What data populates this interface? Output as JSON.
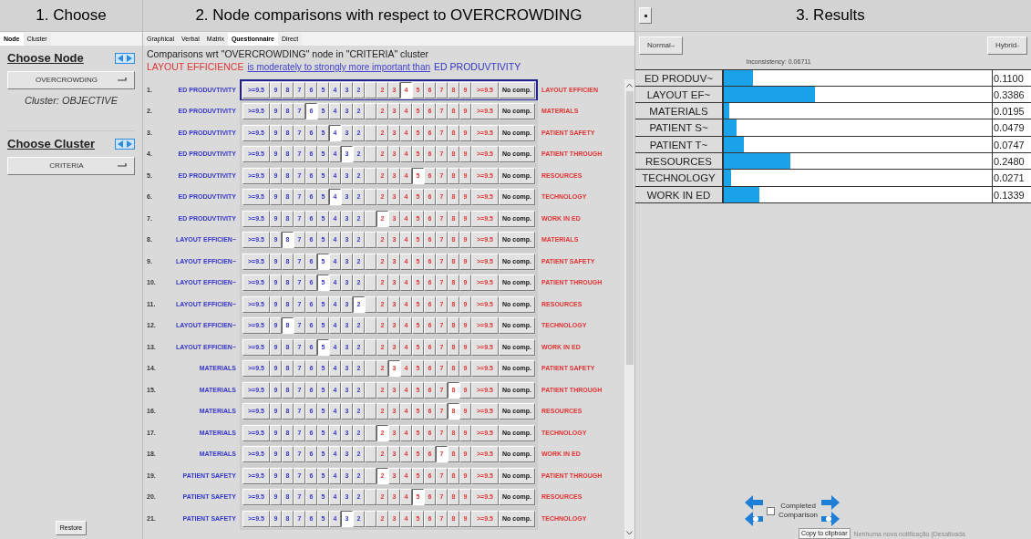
{
  "choose_panel": {
    "title": "1. Choose",
    "tabs": [
      {
        "label": "Node",
        "selected": true
      },
      {
        "label": "Cluster",
        "selected": false
      }
    ],
    "node_heading": "Choose Node",
    "node_dropdown": "OVERCROWDING",
    "cluster_note": "Cluster: OBJECTIVE",
    "cluster_heading": "Choose Cluster",
    "cluster_dropdown": "CRITERIA",
    "restore_button": "Restore"
  },
  "comparison_panel": {
    "title": "2. Node comparisons with respect to OVERCROWDING",
    "tabs": [
      {
        "label": "Graphical",
        "selected": false
      },
      {
        "label": "Verbal",
        "selected": false
      },
      {
        "label": "Matrix",
        "selected": false
      },
      {
        "label": "Questionnaire",
        "selected": true
      },
      {
        "label": "Direct",
        "selected": false
      }
    ],
    "context": "Comparisons wrt \"OVERCROWDING\" node in \"CRITERIA\" cluster",
    "statement": {
      "more_important": "LAYOUT EFFICIENCE",
      "relation": "is moderately to strongly more important than",
      "less_important": "ED PRODUVTIVITY"
    },
    "rows": [
      {
        "number": "1.",
        "selected": true,
        "left": "ED PRODUVTIVITY",
        "right": "LAYOUT EFFICIEN",
        "no_comp": "No comp.",
        "left_scale": [
          {
            "label": ">=9.5",
            "selected": false
          },
          {
            "label": "9",
            "selected": false
          },
          {
            "label": "8",
            "selected": false
          },
          {
            "label": "7",
            "selected": false
          },
          {
            "label": "6",
            "selected": false
          },
          {
            "label": "5",
            "selected": false
          },
          {
            "label": "4",
            "selected": false
          },
          {
            "label": "3",
            "selected": false
          },
          {
            "label": "2",
            "selected": false
          }
        ],
        "right_scale": [
          {
            "label": "2",
            "selected": false
          },
          {
            "label": "3",
            "selected": false
          },
          {
            "label": "4",
            "selected": true
          },
          {
            "label": "5",
            "selected": false
          },
          {
            "label": "6",
            "selected": false
          },
          {
            "label": "7",
            "selected": false
          },
          {
            "label": "8",
            "selected": false
          },
          {
            "label": "9",
            "selected": false
          },
          {
            "label": ">=9.5",
            "selected": false
          }
        ]
      },
      {
        "number": "2.",
        "selected": false,
        "left": "ED PRODUVTIVITY",
        "right": "MATERIALS",
        "no_comp": "No comp.",
        "left_scale": [
          {
            "label": ">=9.5",
            "selected": false
          },
          {
            "label": "9",
            "selected": false
          },
          {
            "label": "8",
            "selected": false
          },
          {
            "label": "7",
            "selected": false
          },
          {
            "label": "6",
            "selected": true
          },
          {
            "label": "5",
            "selected": false
          },
          {
            "label": "4",
            "selected": false
          },
          {
            "label": "3",
            "selected": false
          },
          {
            "label": "2",
            "selected": false
          }
        ],
        "right_scale": [
          {
            "label": "2",
            "selected": false
          },
          {
            "label": "3",
            "selected": false
          },
          {
            "label": "4",
            "selected": false
          },
          {
            "label": "5",
            "selected": false
          },
          {
            "label": "6",
            "selected": false
          },
          {
            "label": "7",
            "selected": false
          },
          {
            "label": "8",
            "selected": false
          },
          {
            "label": "9",
            "selected": false
          },
          {
            "label": ">=9.5",
            "selected": false
          }
        ]
      },
      {
        "number": "3.",
        "selected": false,
        "left": "ED PRODUVTIVITY",
        "right": "PATIENT SAFETY",
        "no_comp": "No comp.",
        "left_scale": [
          {
            "label": ">=9.5",
            "selected": false
          },
          {
            "label": "9",
            "selected": false
          },
          {
            "label": "8",
            "selected": false
          },
          {
            "label": "7",
            "selected": false
          },
          {
            "label": "6",
            "selected": false
          },
          {
            "label": "5",
            "selected": false
          },
          {
            "label": "4",
            "selected": true
          },
          {
            "label": "3",
            "selected": false
          },
          {
            "label": "2",
            "selected": false
          }
        ],
        "right_scale": [
          {
            "label": "2",
            "selected": false
          },
          {
            "label": "3",
            "selected": false
          },
          {
            "label": "4",
            "selected": false
          },
          {
            "label": "5",
            "selected": false
          },
          {
            "label": "6",
            "selected": false
          },
          {
            "label": "7",
            "selected": false
          },
          {
            "label": "8",
            "selected": false
          },
          {
            "label": "9",
            "selected": false
          },
          {
            "label": ">=9.5",
            "selected": false
          }
        ]
      },
      {
        "number": "4.",
        "selected": false,
        "left": "ED PRODUVTIVITY",
        "right": "PATIENT THROUGH",
        "no_comp": "No comp.",
        "left_scale": [
          {
            "label": ">=9.5",
            "selected": false
          },
          {
            "label": "9",
            "selected": false
          },
          {
            "label": "8",
            "selected": false
          },
          {
            "label": "7",
            "selected": false
          },
          {
            "label": "6",
            "selected": false
          },
          {
            "label": "5",
            "selected": false
          },
          {
            "label": "4",
            "selected": false
          },
          {
            "label": "3",
            "selected": true
          },
          {
            "label": "2",
            "selected": false
          }
        ],
        "right_scale": [
          {
            "label": "2",
            "selected": false
          },
          {
            "label": "3",
            "selected": false
          },
          {
            "label": "4",
            "selected": false
          },
          {
            "label": "5",
            "selected": false
          },
          {
            "label": "6",
            "selected": false
          },
          {
            "label": "7",
            "selected": false
          },
          {
            "label": "8",
            "selected": false
          },
          {
            "label": "9",
            "selected": false
          },
          {
            "label": ">=9.5",
            "selected": false
          }
        ]
      },
      {
        "number": "5.",
        "selected": false,
        "left": "ED PRODUVTIVITY",
        "right": "RESOURCES",
        "no_comp": "No comp.",
        "left_scale": [
          {
            "label": ">=9.5",
            "selected": false
          },
          {
            "label": "9",
            "selected": false
          },
          {
            "label": "8",
            "selected": false
          },
          {
            "label": "7",
            "selected": false
          },
          {
            "label": "6",
            "selected": false
          },
          {
            "label": "5",
            "selected": false
          },
          {
            "label": "4",
            "selected": false
          },
          {
            "label": "3",
            "selected": false
          },
          {
            "label": "2",
            "selected": false
          }
        ],
        "right_scale": [
          {
            "label": "2",
            "selected": false
          },
          {
            "label": "3",
            "selected": false
          },
          {
            "label": "4",
            "selected": false
          },
          {
            "label": "5",
            "selected": true
          },
          {
            "label": "6",
            "selected": false
          },
          {
            "label": "7",
            "selected": false
          },
          {
            "label": "8",
            "selected": false
          },
          {
            "label": "9",
            "selected": false
          },
          {
            "label": ">=9.5",
            "selected": false
          }
        ]
      },
      {
        "number": "6.",
        "selected": false,
        "left": "ED PRODUVTIVITY",
        "right": "TECHNOLOGY",
        "no_comp": "No comp.",
        "left_scale": [
          {
            "label": ">=9.5",
            "selected": false
          },
          {
            "label": "9",
            "selected": false
          },
          {
            "label": "8",
            "selected": false
          },
          {
            "label": "7",
            "selected": false
          },
          {
            "label": "6",
            "selected": false
          },
          {
            "label": "5",
            "selected": false
          },
          {
            "label": "4",
            "selected": true
          },
          {
            "label": "3",
            "selected": false
          },
          {
            "label": "2",
            "selected": false
          }
        ],
        "right_scale": [
          {
            "label": "2",
            "selected": false
          },
          {
            "label": "3",
            "selected": false
          },
          {
            "label": "4",
            "selected": false
          },
          {
            "label": "5",
            "selected": false
          },
          {
            "label": "6",
            "selected": false
          },
          {
            "label": "7",
            "selected": false
          },
          {
            "label": "8",
            "selected": false
          },
          {
            "label": "9",
            "selected": false
          },
          {
            "label": ">=9.5",
            "selected": false
          }
        ]
      },
      {
        "number": "7.",
        "selected": false,
        "left": "ED PRODUVTIVITY",
        "right": "WORK IN ED",
        "no_comp": "No comp.",
        "left_scale": [
          {
            "label": ">=9.5",
            "selected": false
          },
          {
            "label": "9",
            "selected": false
          },
          {
            "label": "8",
            "selected": false
          },
          {
            "label": "7",
            "selected": false
          },
          {
            "label": "6",
            "selected": false
          },
          {
            "label": "5",
            "selected": false
          },
          {
            "label": "4",
            "selected": false
          },
          {
            "label": "3",
            "selected": false
          },
          {
            "label": "2",
            "selected": false
          }
        ],
        "right_scale": [
          {
            "label": "2",
            "selected": true
          },
          {
            "label": "3",
            "selected": false
          },
          {
            "label": "4",
            "selected": false
          },
          {
            "label": "5",
            "selected": false
          },
          {
            "label": "6",
            "selected": false
          },
          {
            "label": "7",
            "selected": false
          },
          {
            "label": "8",
            "selected": false
          },
          {
            "label": "9",
            "selected": false
          },
          {
            "label": ">=9.5",
            "selected": false
          }
        ]
      },
      {
        "number": "8.",
        "selected": false,
        "left": "LAYOUT EFFICIEN~",
        "right": "MATERIALS",
        "no_comp": "No comp.",
        "left_scale": [
          {
            "label": ">=9.5",
            "selected": false
          },
          {
            "label": "9",
            "selected": false
          },
          {
            "label": "8",
            "selected": true
          },
          {
            "label": "7",
            "selected": false
          },
          {
            "label": "6",
            "selected": false
          },
          {
            "label": "5",
            "selected": false
          },
          {
            "label": "4",
            "selected": false
          },
          {
            "label": "3",
            "selected": false
          },
          {
            "label": "2",
            "selected": false
          }
        ],
        "right_scale": [
          {
            "label": "2",
            "selected": false
          },
          {
            "label": "3",
            "selected": false
          },
          {
            "label": "4",
            "selected": false
          },
          {
            "label": "5",
            "selected": false
          },
          {
            "label": "6",
            "selected": false
          },
          {
            "label": "7",
            "selected": false
          },
          {
            "label": "8",
            "selected": false
          },
          {
            "label": "9",
            "selected": false
          },
          {
            "label": ">=9.5",
            "selected": false
          }
        ]
      },
      {
        "number": "9.",
        "selected": false,
        "left": "LAYOUT EFFICIEN~",
        "right": "PATIENT SAFETY",
        "no_comp": "No comp.",
        "left_scale": [
          {
            "label": ">=9.5",
            "selected": false
          },
          {
            "label": "9",
            "selected": false
          },
          {
            "label": "8",
            "selected": false
          },
          {
            "label": "7",
            "selected": false
          },
          {
            "label": "6",
            "selected": false
          },
          {
            "label": "5",
            "selected": true
          },
          {
            "label": "4",
            "selected": false
          },
          {
            "label": "3",
            "selected": false
          },
          {
            "label": "2",
            "selected": false
          }
        ],
        "right_scale": [
          {
            "label": "2",
            "selected": false
          },
          {
            "label": "3",
            "selected": false
          },
          {
            "label": "4",
            "selected": false
          },
          {
            "label": "5",
            "selected": false
          },
          {
            "label": "6",
            "selected": false
          },
          {
            "label": "7",
            "selected": false
          },
          {
            "label": "8",
            "selected": false
          },
          {
            "label": "9",
            "selected": false
          },
          {
            "label": ">=9.5",
            "selected": false
          }
        ]
      },
      {
        "number": "10.",
        "selected": false,
        "left": "LAYOUT EFFICIEN~",
        "right": "PATIENT THROUGH",
        "no_comp": "No comp.",
        "left_scale": [
          {
            "label": ">=9.5",
            "selected": false
          },
          {
            "label": "9",
            "selected": false
          },
          {
            "label": "8",
            "selected": false
          },
          {
            "label": "7",
            "selected": false
          },
          {
            "label": "6",
            "selected": false
          },
          {
            "label": "5",
            "selected": true
          },
          {
            "label": "4",
            "selected": false
          },
          {
            "label": "3",
            "selected": false
          },
          {
            "label": "2",
            "selected": false
          }
        ],
        "right_scale": [
          {
            "label": "2",
            "selected": false
          },
          {
            "label": "3",
            "selected": false
          },
          {
            "label": "4",
            "selected": false
          },
          {
            "label": "5",
            "selected": false
          },
          {
            "label": "6",
            "selected": false
          },
          {
            "label": "7",
            "selected": false
          },
          {
            "label": "8",
            "selected": false
          },
          {
            "label": "9",
            "selected": false
          },
          {
            "label": ">=9.5",
            "selected": false
          }
        ]
      },
      {
        "number": "11.",
        "selected": false,
        "left": "LAYOUT EFFICIEN~",
        "right": "RESOURCES",
        "no_comp": "No comp.",
        "left_scale": [
          {
            "label": ">=9.5",
            "selected": false
          },
          {
            "label": "9",
            "selected": false
          },
          {
            "label": "8",
            "selected": false
          },
          {
            "label": "7",
            "selected": false
          },
          {
            "label": "6",
            "selected": false
          },
          {
            "label": "5",
            "selected": false
          },
          {
            "label": "4",
            "selected": false
          },
          {
            "label": "3",
            "selected": false
          },
          {
            "label": "2",
            "selected": true
          }
        ],
        "right_scale": [
          {
            "label": "2",
            "selected": false
          },
          {
            "label": "3",
            "selected": false
          },
          {
            "label": "4",
            "selected": false
          },
          {
            "label": "5",
            "selected": false
          },
          {
            "label": "6",
            "selected": false
          },
          {
            "label": "7",
            "selected": false
          },
          {
            "label": "8",
            "selected": false
          },
          {
            "label": "9",
            "selected": false
          },
          {
            "label": ">=9.5",
            "selected": false
          }
        ]
      },
      {
        "number": "12.",
        "selected": false,
        "left": "LAYOUT EFFICIEN~",
        "right": "TECHNOLOGY",
        "no_comp": "No comp.",
        "left_scale": [
          {
            "label": ">=9.5",
            "selected": false
          },
          {
            "label": "9",
            "selected": false
          },
          {
            "label": "8",
            "selected": true
          },
          {
            "label": "7",
            "selected": false
          },
          {
            "label": "6",
            "selected": false
          },
          {
            "label": "5",
            "selected": false
          },
          {
            "label": "4",
            "selected": false
          },
          {
            "label": "3",
            "selected": false
          },
          {
            "label": "2",
            "selected": false
          }
        ],
        "right_scale": [
          {
            "label": "2",
            "selected": false
          },
          {
            "label": "3",
            "selected": false
          },
          {
            "label": "4",
            "selected": false
          },
          {
            "label": "5",
            "selected": false
          },
          {
            "label": "6",
            "selected": false
          },
          {
            "label": "7",
            "selected": false
          },
          {
            "label": "8",
            "selected": false
          },
          {
            "label": "9",
            "selected": false
          },
          {
            "label": ">=9.5",
            "selected": false
          }
        ]
      },
      {
        "number": "13.",
        "selected": false,
        "left": "LAYOUT EFFICIEN~",
        "right": "WORK IN ED",
        "no_comp": "No comp.",
        "left_scale": [
          {
            "label": ">=9.5",
            "selected": false
          },
          {
            "label": "9",
            "selected": false
          },
          {
            "label": "8",
            "selected": false
          },
          {
            "label": "7",
            "selected": false
          },
          {
            "label": "6",
            "selected": false
          },
          {
            "label": "5",
            "selected": true
          },
          {
            "label": "4",
            "selected": false
          },
          {
            "label": "3",
            "selected": false
          },
          {
            "label": "2",
            "selected": false
          }
        ],
        "right_scale": [
          {
            "label": "2",
            "selected": false
          },
          {
            "label": "3",
            "selected": false
          },
          {
            "label": "4",
            "selected": false
          },
          {
            "label": "5",
            "selected": false
          },
          {
            "label": "6",
            "selected": false
          },
          {
            "label": "7",
            "selected": false
          },
          {
            "label": "8",
            "selected": false
          },
          {
            "label": "9",
            "selected": false
          },
          {
            "label": ">=9.5",
            "selected": false
          }
        ]
      },
      {
        "number": "14.",
        "selected": false,
        "left": "MATERIALS",
        "right": "PATIENT SAFETY",
        "no_comp": "No comp.",
        "left_scale": [
          {
            "label": ">=9.5",
            "selected": false
          },
          {
            "label": "9",
            "selected": false
          },
          {
            "label": "8",
            "selected": false
          },
          {
            "label": "7",
            "selected": false
          },
          {
            "label": "6",
            "selected": false
          },
          {
            "label": "5",
            "selected": false
          },
          {
            "label": "4",
            "selected": false
          },
          {
            "label": "3",
            "selected": false
          },
          {
            "label": "2",
            "selected": false
          }
        ],
        "right_scale": [
          {
            "label": "2",
            "selected": false
          },
          {
            "label": "3",
            "selected": true
          },
          {
            "label": "4",
            "selected": false
          },
          {
            "label": "5",
            "selected": false
          },
          {
            "label": "6",
            "selected": false
          },
          {
            "label": "7",
            "selected": false
          },
          {
            "label": "8",
            "selected": false
          },
          {
            "label": "9",
            "selected": false
          },
          {
            "label": ">=9.5",
            "selected": false
          }
        ]
      },
      {
        "number": "15.",
        "selected": false,
        "left": "MATERIALS",
        "right": "PATIENT THROUGH",
        "no_comp": "No comp.",
        "left_scale": [
          {
            "label": ">=9.5",
            "selected": false
          },
          {
            "label": "9",
            "selected": false
          },
          {
            "label": "8",
            "selected": false
          },
          {
            "label": "7",
            "selected": false
          },
          {
            "label": "6",
            "selected": false
          },
          {
            "label": "5",
            "selected": false
          },
          {
            "label": "4",
            "selected": false
          },
          {
            "label": "3",
            "selected": false
          },
          {
            "label": "2",
            "selected": false
          }
        ],
        "right_scale": [
          {
            "label": "2",
            "selected": false
          },
          {
            "label": "3",
            "selected": false
          },
          {
            "label": "4",
            "selected": false
          },
          {
            "label": "5",
            "selected": false
          },
          {
            "label": "6",
            "selected": false
          },
          {
            "label": "7",
            "selected": false
          },
          {
            "label": "8",
            "selected": true
          },
          {
            "label": "9",
            "selected": false
          },
          {
            "label": ">=9.5",
            "selected": false
          }
        ]
      },
      {
        "number": "16.",
        "selected": false,
        "left": "MATERIALS",
        "right": "RESOURCES",
        "no_comp": "No comp.",
        "left_scale": [
          {
            "label": ">=9.5",
            "selected": false
          },
          {
            "label": "9",
            "selected": false
          },
          {
            "label": "8",
            "selected": false
          },
          {
            "label": "7",
            "selected": false
          },
          {
            "label": "6",
            "selected": false
          },
          {
            "label": "5",
            "selected": false
          },
          {
            "label": "4",
            "selected": false
          },
          {
            "label": "3",
            "selected": false
          },
          {
            "label": "2",
            "selected": false
          }
        ],
        "right_scale": [
          {
            "label": "2",
            "selected": false
          },
          {
            "label": "3",
            "selected": false
          },
          {
            "label": "4",
            "selected": false
          },
          {
            "label": "5",
            "selected": false
          },
          {
            "label": "6",
            "selected": false
          },
          {
            "label": "7",
            "selected": false
          },
          {
            "label": "8",
            "selected": true
          },
          {
            "label": "9",
            "selected": false
          },
          {
            "label": ">=9.5",
            "selected": false
          }
        ]
      },
      {
        "number": "17.",
        "selected": false,
        "left": "MATERIALS",
        "right": "TECHNOLOGY",
        "no_comp": "No comp.",
        "left_scale": [
          {
            "label": ">=9.5",
            "selected": false
          },
          {
            "label": "9",
            "selected": false
          },
          {
            "label": "8",
            "selected": false
          },
          {
            "label": "7",
            "selected": false
          },
          {
            "label": "6",
            "selected": false
          },
          {
            "label": "5",
            "selected": false
          },
          {
            "label": "4",
            "selected": false
          },
          {
            "label": "3",
            "selected": false
          },
          {
            "label": "2",
            "selected": false
          }
        ],
        "right_scale": [
          {
            "label": "2",
            "selected": true
          },
          {
            "label": "3",
            "selected": false
          },
          {
            "label": "4",
            "selected": false
          },
          {
            "label": "5",
            "selected": false
          },
          {
            "label": "6",
            "selected": false
          },
          {
            "label": "7",
            "selected": false
          },
          {
            "label": "8",
            "selected": false
          },
          {
            "label": "9",
            "selected": false
          },
          {
            "label": ">=9.5",
            "selected": false
          }
        ]
      },
      {
        "number": "18.",
        "selected": false,
        "left": "MATERIALS",
        "right": "WORK IN ED",
        "no_comp": "No comp.",
        "left_scale": [
          {
            "label": ">=9.5",
            "selected": false
          },
          {
            "label": "9",
            "selected": false
          },
          {
            "label": "8",
            "selected": false
          },
          {
            "label": "7",
            "selected": false
          },
          {
            "label": "6",
            "selected": false
          },
          {
            "label": "5",
            "selected": false
          },
          {
            "label": "4",
            "selected": false
          },
          {
            "label": "3",
            "selected": false
          },
          {
            "label": "2",
            "selected": false
          }
        ],
        "right_scale": [
          {
            "label": "2",
            "selected": false
          },
          {
            "label": "3",
            "selected": false
          },
          {
            "label": "4",
            "selected": false
          },
          {
            "label": "5",
            "selected": false
          },
          {
            "label": "6",
            "selected": false
          },
          {
            "label": "7",
            "selected": true
          },
          {
            "label": "8",
            "selected": false
          },
          {
            "label": "9",
            "selected": false
          },
          {
            "label": ">=9.5",
            "selected": false
          }
        ]
      },
      {
        "number": "19.",
        "selected": false,
        "left": "PATIENT SAFETY",
        "right": "PATIENT THROUGH",
        "no_comp": "No comp.",
        "left_scale": [
          {
            "label": ">=9.5",
            "selected": false
          },
          {
            "label": "9",
            "selected": false
          },
          {
            "label": "8",
            "selected": false
          },
          {
            "label": "7",
            "selected": false
          },
          {
            "label": "6",
            "selected": false
          },
          {
            "label": "5",
            "selected": false
          },
          {
            "label": "4",
            "selected": false
          },
          {
            "label": "3",
            "selected": false
          },
          {
            "label": "2",
            "selected": false
          }
        ],
        "right_scale": [
          {
            "label": "2",
            "selected": true
          },
          {
            "label": "3",
            "selected": false
          },
          {
            "label": "4",
            "selected": false
          },
          {
            "label": "5",
            "selected": false
          },
          {
            "label": "6",
            "selected": false
          },
          {
            "label": "7",
            "selected": false
          },
          {
            "label": "8",
            "selected": false
          },
          {
            "label": "9",
            "selected": false
          },
          {
            "label": ">=9.5",
            "selected": false
          }
        ]
      },
      {
        "number": "20.",
        "selected": false,
        "left": "PATIENT SAFETY",
        "right": "RESOURCES",
        "no_comp": "No comp.",
        "left_scale": [
          {
            "label": ">=9.5",
            "selected": false
          },
          {
            "label": "9",
            "selected": false
          },
          {
            "label": "8",
            "selected": false
          },
          {
            "label": "7",
            "selected": false
          },
          {
            "label": "6",
            "selected": false
          },
          {
            "label": "5",
            "selected": false
          },
          {
            "label": "4",
            "selected": false
          },
          {
            "label": "3",
            "selected": false
          },
          {
            "label": "2",
            "selected": false
          }
        ],
        "right_scale": [
          {
            "label": "2",
            "selected": false
          },
          {
            "label": "3",
            "selected": false
          },
          {
            "label": "4",
            "selected": false
          },
          {
            "label": "5",
            "selected": true
          },
          {
            "label": "6",
            "selected": false
          },
          {
            "label": "7",
            "selected": false
          },
          {
            "label": "8",
            "selected": false
          },
          {
            "label": "9",
            "selected": false
          },
          {
            "label": ">=9.5",
            "selected": false
          }
        ]
      },
      {
        "number": "21.",
        "selected": false,
        "left": "PATIENT SAFETY",
        "right": "TECHNOLOGY",
        "no_comp": "No comp.",
        "left_scale": [
          {
            "label": ">=9.5",
            "selected": false
          },
          {
            "label": "9",
            "selected": false
          },
          {
            "label": "8",
            "selected": false
          },
          {
            "label": "7",
            "selected": false
          },
          {
            "label": "6",
            "selected": false
          },
          {
            "label": "5",
            "selected": false
          },
          {
            "label": "4",
            "selected": false
          },
          {
            "label": "3",
            "selected": true
          },
          {
            "label": "2",
            "selected": false
          }
        ],
        "right_scale": [
          {
            "label": "2",
            "selected": false
          },
          {
            "label": "3",
            "selected": false
          },
          {
            "label": "4",
            "selected": false
          },
          {
            "label": "5",
            "selected": false
          },
          {
            "label": "6",
            "selected": false
          },
          {
            "label": "7",
            "selected": false
          },
          {
            "label": "8",
            "selected": false
          },
          {
            "label": "9",
            "selected": false
          },
          {
            "label": ">=9.5",
            "selected": false
          }
        ]
      }
    ]
  },
  "results_panel": {
    "title": "3. Results",
    "mode_dropdown": "Normal",
    "method_dropdown": "Hybrid",
    "inconsistency": "Inconsistency: 0.06711",
    "priorities": [
      {
        "label": "ED PRODUV~",
        "level": 0.11,
        "value": "0.1100"
      },
      {
        "label": "LAYOUT EF~",
        "level": 0.3386,
        "value": "0.3386"
      },
      {
        "label": "MATERIALS",
        "level": 0.0195,
        "value": "0.0195"
      },
      {
        "label": "PATIENT S~",
        "level": 0.0479,
        "value": "0.0479"
      },
      {
        "label": "PATIENT T~",
        "level": 0.0747,
        "value": "0.0747"
      },
      {
        "label": "RESOURCES",
        "level": 0.248,
        "value": "0.2480"
      },
      {
        "label": "TECHNOLOGY",
        "level": 0.0271,
        "value": "0.0271"
      },
      {
        "label": "WORK IN ED",
        "level": 0.1339,
        "value": "0.1339"
      }
    ],
    "completed": {
      "label_line1": "Completed",
      "label_line2": "Comparison",
      "checked": false
    },
    "tooltip": "Copy to clipboar",
    "notification": "Nenhuma nova notificação (Desativada"
  }
}
